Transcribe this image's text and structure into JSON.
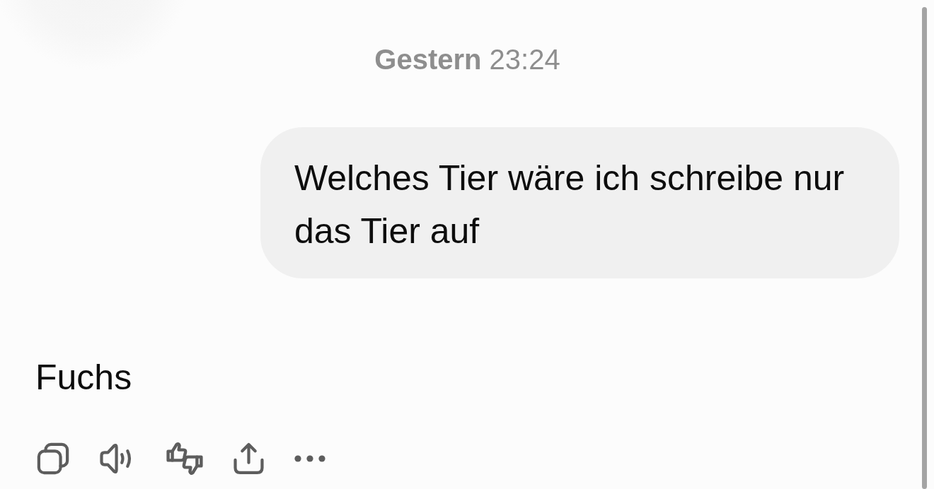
{
  "timestamp": "**Gestern** 23:24",
  "messages": [
    {
      "kind": "user",
      "text": "Welches Tier wäre ich schreibe nur das Tier auf"
    },
    {
      "kind": "assistant",
      "text": "Fuchs"
    }
  ]
}
